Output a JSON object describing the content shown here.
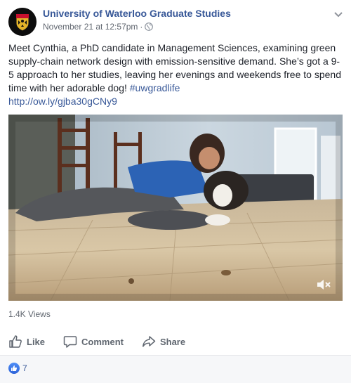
{
  "header": {
    "page_name": "University of Waterloo Graduate Studies",
    "timestamp": "November 21 at 12:57pm",
    "separator": "·",
    "privacy_icon": "globe-icon",
    "menu_icon": "chevron-down-icon"
  },
  "post": {
    "text_main": "Meet Cynthia, a PhD candidate in Management Sciences, examining green supply-chain network design with emission-sensitive demand. She’s got a 9-5 approach to her studies, leaving her evenings and weekends free to spend time with her adorable dog! ",
    "hashtag": "#uwgradlife",
    "link": "http://ow.ly/gjba30gCNy9"
  },
  "video": {
    "mute_icon": "speaker-muted-icon"
  },
  "stats": {
    "views": "1.4K Views",
    "reaction_count": "7"
  },
  "actions": {
    "like_label": "Like",
    "comment_label": "Comment",
    "share_label": "Share"
  },
  "colors": {
    "link": "#385898",
    "secondary_text": "#616770",
    "like_blue": "#2e63d8"
  }
}
